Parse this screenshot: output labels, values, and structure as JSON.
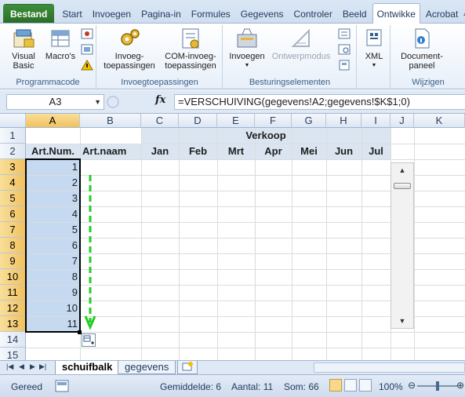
{
  "ribbon_tabs": [
    {
      "label": "Bestand"
    },
    {
      "label": "Start"
    },
    {
      "label": "Invoegen"
    },
    {
      "label": "Pagina-in"
    },
    {
      "label": "Formules"
    },
    {
      "label": "Gegevens"
    },
    {
      "label": "Controler"
    },
    {
      "label": "Beeld"
    },
    {
      "label": "Ontwikke"
    },
    {
      "label": "Acrobat"
    }
  ],
  "ribbon": {
    "visual_basic": "Visual Basic",
    "visual_basic_l1": "Visual",
    "visual_basic_l2": "Basic",
    "macros": "Macro's",
    "group_code": "Programmacode",
    "addins_l1": "Invoeg-",
    "addins_l2": "toepassingen",
    "com_addins_l1": "COM-invoeg-",
    "com_addins_l2": "toepassingen",
    "group_addins": "Invoegtoepassingen",
    "insert": "Invoegen",
    "design_mode": "Ontwerpmodus",
    "group_controls": "Besturingselementen",
    "xml": "XML",
    "docpanel_l1": "Document-",
    "docpanel_l2": "paneel",
    "group_modify": "Wijzigen"
  },
  "formula_bar": {
    "name_box": "A3",
    "fx": "fx",
    "formula": "=VERSCHUIVING(gegevens!A2;gegevens!$K$1;0)"
  },
  "columns": [
    "A",
    "B",
    "C",
    "D",
    "E",
    "F",
    "G",
    "H",
    "I",
    "J",
    "K"
  ],
  "rows": [
    "1",
    "2",
    "3",
    "4",
    "5",
    "6",
    "7",
    "8",
    "9",
    "10",
    "11",
    "12",
    "13",
    "14",
    "15"
  ],
  "sheet": {
    "title_verkoop": "Verkoop",
    "headers": [
      "Art.Num.",
      "Art.naam",
      "Jan",
      "Feb",
      "Mrt",
      "Apr",
      "Mei",
      "Jun",
      "Jul"
    ],
    "values": [
      "1",
      "2",
      "3",
      "4",
      "5",
      "6",
      "7",
      "8",
      "9",
      "10",
      "11"
    ]
  },
  "sheet_tabs": [
    {
      "label": "schuifbalk"
    },
    {
      "label": "gegevens"
    }
  ],
  "status": {
    "ready": "Gereed",
    "average": "Gemiddelde: 6",
    "count": "Aantal: 11",
    "sum": "Som: 66",
    "zoom": "100%"
  },
  "colors": {
    "file_tab": "#2a6e27",
    "selection": "#c5d9f1",
    "header_band": "#dbe5f1",
    "selected_header": "#f1c15f",
    "arrow": "#22cc22"
  }
}
